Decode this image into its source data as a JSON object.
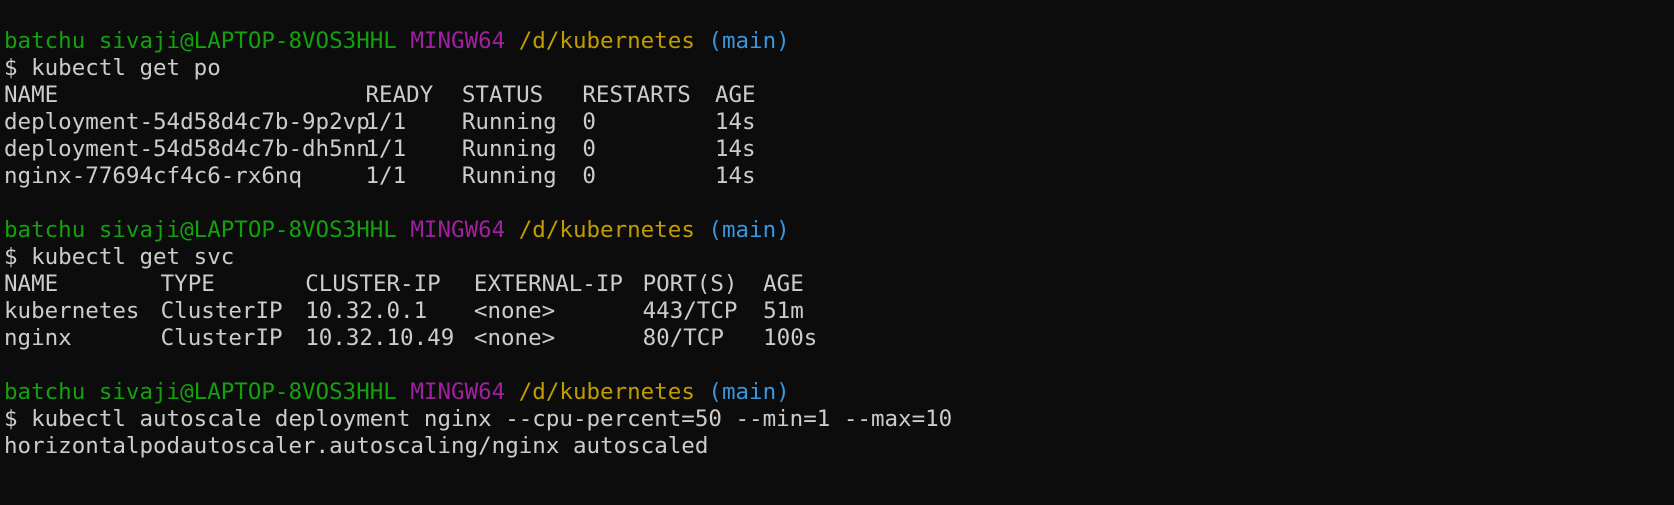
{
  "prompt": {
    "user_host": "batchu sivaji@LAPTOP-8VOS3HHL",
    "shell": "MINGW64",
    "cwd": "/d/kubernetes",
    "branch": "(main)",
    "symbol": "$"
  },
  "blocks": [
    {
      "command": "kubectl get po",
      "headers": [
        "NAME",
        "READY",
        "STATUS",
        "RESTARTS",
        "AGE"
      ],
      "rows": [
        [
          "deployment-54d58d4c7b-9p2vp",
          "1/1",
          "Running",
          "0",
          "14s"
        ],
        [
          "deployment-54d58d4c7b-dh5nn",
          "1/1",
          "Running",
          "0",
          "14s"
        ],
        [
          "nginx-77694cf4c6-rx6nq",
          "1/1",
          "Running",
          "0",
          "14s"
        ]
      ]
    },
    {
      "command": "kubectl get svc",
      "headers": [
        "NAME",
        "TYPE",
        "CLUSTER-IP",
        "EXTERNAL-IP",
        "PORT(S)",
        "AGE"
      ],
      "rows": [
        [
          "kubernetes",
          "ClusterIP",
          "10.32.0.1",
          "<none>",
          "443/TCP",
          "51m"
        ],
        [
          "nginx",
          "ClusterIP",
          "10.32.10.49",
          "<none>",
          "80/TCP",
          "100s"
        ]
      ]
    },
    {
      "command": "kubectl autoscale deployment nginx --cpu-percent=50 --min=1 --max=10",
      "output": "horizontalpodautoscaler.autoscaling/nginx autoscaled"
    }
  ],
  "colors": {
    "background": "#0c0c0c",
    "text": "#cccccc",
    "user_host": "#13a10e",
    "shell": "#a020a0",
    "cwd": "#c19c00",
    "branch": "#3a96dd"
  }
}
